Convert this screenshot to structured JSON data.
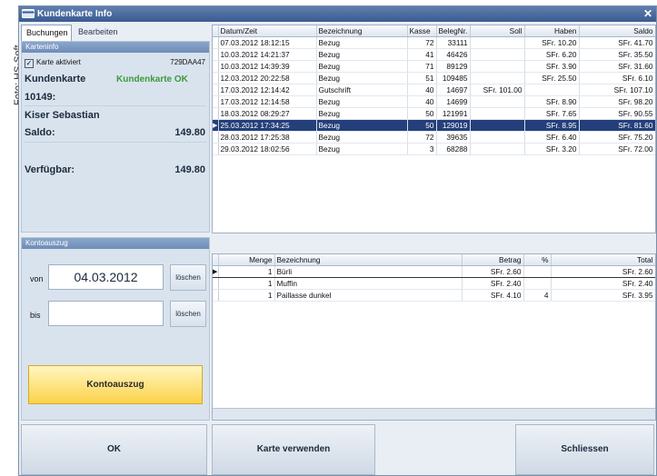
{
  "credit": "Foto: HS-Soft",
  "window": {
    "title": "Kundenkarte Info",
    "close_glyph": "✕"
  },
  "tabs": [
    {
      "label": "Buchungen"
    },
    {
      "label": "Bearbeiten"
    }
  ],
  "card": {
    "header": "Karteninfo",
    "activated_label": "Karte aktiviert",
    "activated_checked": true,
    "card_number": "729DAA47",
    "card_title": "Kundenkarte",
    "card_status": "Kundenkarte OK",
    "customer_number": "10149:",
    "customer_name": "Kiser Sebastian",
    "saldo_label": "Saldo:",
    "saldo_value": "149.80",
    "available_label": "Verfügbar:",
    "available_value": "149.80"
  },
  "statement": {
    "header": "Kontoauszug",
    "from_label": "von",
    "from_value": "04.03.2012",
    "to_label": "bis",
    "to_value": "",
    "clear_label": "löschen",
    "button_label": "Kontoauszug"
  },
  "bookings": {
    "columns": [
      "Datum/Zeit",
      "Bezeichnung",
      "Kasse",
      "BelegNr.",
      "Soll",
      "Haben",
      "Saldo"
    ],
    "rows": [
      {
        "datetime": "07.03.2012 18:12:15",
        "desc": "Bezug",
        "kasse": "72",
        "beleg": "33111",
        "soll": "",
        "haben": "SFr. 10.20",
        "saldo": "SFr. 41.70"
      },
      {
        "datetime": "10.03.2012 14:21:37",
        "desc": "Bezug",
        "kasse": "41",
        "beleg": "46426",
        "soll": "",
        "haben": "SFr. 6.20",
        "saldo": "SFr. 35.50"
      },
      {
        "datetime": "10.03.2012 14:39:39",
        "desc": "Bezug",
        "kasse": "71",
        "beleg": "89129",
        "soll": "",
        "haben": "SFr. 3.90",
        "saldo": "SFr. 31.60"
      },
      {
        "datetime": "12.03.2012 20:22:58",
        "desc": "Bezug",
        "kasse": "51",
        "beleg": "109485",
        "soll": "",
        "haben": "SFr. 25.50",
        "saldo": "SFr. 6.10"
      },
      {
        "datetime": "17.03.2012 12:14:42",
        "desc": "Gutschrift",
        "kasse": "40",
        "beleg": "14697",
        "soll": "SFr. 101.00",
        "haben": "",
        "saldo": "SFr. 107.10"
      },
      {
        "datetime": "17.03.2012 12:14:58",
        "desc": "Bezug",
        "kasse": "40",
        "beleg": "14699",
        "soll": "",
        "haben": "SFr. 8.90",
        "saldo": "SFr. 98.20"
      },
      {
        "datetime": "18.03.2012 08:29:27",
        "desc": "Bezug",
        "kasse": "50",
        "beleg": "121991",
        "soll": "",
        "haben": "SFr. 7.65",
        "saldo": "SFr. 90.55"
      },
      {
        "datetime": "25.03.2012 17:34:25",
        "desc": "Bezug",
        "kasse": "50",
        "beleg": "129019",
        "soll": "",
        "haben": "SFr. 8.95",
        "saldo": "SFr. 81.60",
        "selected": true
      },
      {
        "datetime": "28.03.2012 17:25:38",
        "desc": "Bezug",
        "kasse": "72",
        "beleg": "39635",
        "soll": "",
        "haben": "SFr. 6.40",
        "saldo": "SFr. 75.20"
      },
      {
        "datetime": "29.03.2012 18:02:56",
        "desc": "Bezug",
        "kasse": "3",
        "beleg": "68288",
        "soll": "",
        "haben": "SFr. 3.20",
        "saldo": "SFr. 72.00"
      }
    ]
  },
  "details": {
    "columns": [
      "Menge",
      "Bezeichnung",
      "Betrag",
      "%",
      "Total"
    ],
    "rows": [
      {
        "menge": "1",
        "desc": "Bürli",
        "betrag": "SFr. 2.60",
        "pct": "",
        "total": "SFr. 2.60",
        "selected": true
      },
      {
        "menge": "1",
        "desc": "Muffin",
        "betrag": "SFr. 2.40",
        "pct": "",
        "total": "SFr. 2.40"
      },
      {
        "menge": "1",
        "desc": "Paillasse dunkel",
        "betrag": "SFr. 4.10",
        "pct": "4",
        "total": "SFr. 3.95"
      }
    ]
  },
  "footer": {
    "ok_label": "OK",
    "use_card_label": "Karte verwenden",
    "close_label": "Schliessen"
  },
  "colors": {
    "selection": "#243f7a",
    "title_bar": "#3b5b91",
    "status_ok": "#3c9a3c",
    "action_button": "#fbd24a"
  }
}
